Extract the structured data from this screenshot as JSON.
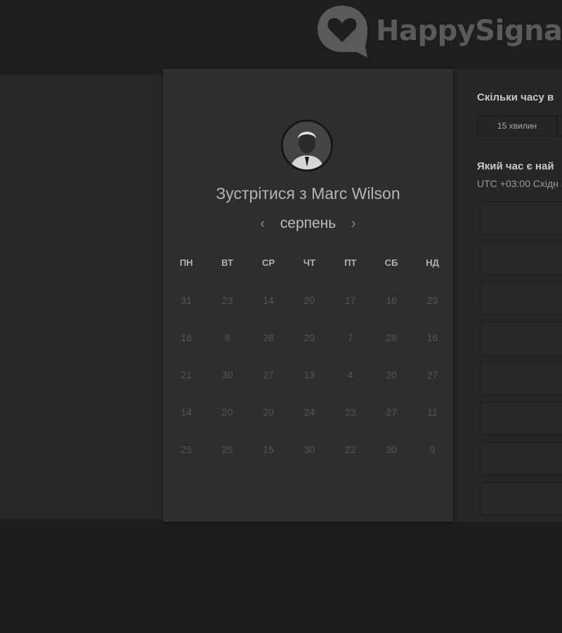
{
  "brand": {
    "name": "HappySigna"
  },
  "booking": {
    "title": "Зустрітися з Marc Wilson",
    "month": "серпень",
    "prev_icon": "chevron-left-icon",
    "next_icon": "chevron-right-icon",
    "weekdays": [
      "ПН",
      "ВТ",
      "СР",
      "ЧТ",
      "ПТ",
      "СБ",
      "НД"
    ],
    "weeks": [
      [
        "31",
        "23",
        "14",
        "20",
        "17",
        "16",
        "23"
      ],
      [
        "16",
        "8",
        "28",
        "29",
        "7",
        "28",
        "16"
      ],
      [
        "21",
        "30",
        "27",
        "13",
        "4",
        "20",
        "27"
      ],
      [
        "14",
        "20",
        "20",
        "24",
        "23",
        "27",
        "11"
      ],
      [
        "25",
        "25",
        "15",
        "30",
        "22",
        "30",
        "9"
      ]
    ]
  },
  "scheduler": {
    "duration_question": "Скільки часу в",
    "duration_value": "15 хвилин",
    "time_question": "Який час є най",
    "timezone": "UTC +03:00 Східн",
    "slot_count_visible": 8
  },
  "colors": {
    "background": "#1f1f1f",
    "card": "#2e2e2e",
    "logo": "#5a5a5a"
  }
}
